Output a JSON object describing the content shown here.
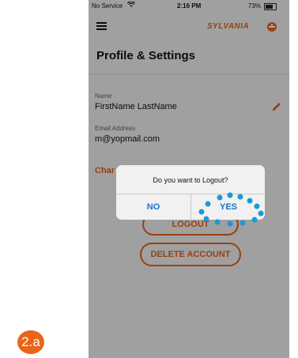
{
  "status_bar": {
    "carrier": "No Service",
    "time": "2:16 PM",
    "battery": "73%"
  },
  "header": {
    "brand": "SYLVANIA",
    "menu_icon": "hamburger-menu-icon"
  },
  "page": {
    "title": "Profile & Settings"
  },
  "profile": {
    "name_label": "Name",
    "name_value": "FirstName LastName",
    "email_label": "Email Address",
    "email_value": "m@yopmail.com",
    "change_link": "Char"
  },
  "buttons": {
    "logout": "LOGOUT",
    "delete_account": "DELETE ACCOUNT"
  },
  "dialog": {
    "message": "Do you want to Logout?",
    "no_label": "NO",
    "yes_label": "YES"
  },
  "step_badge": "2.a",
  "colors": {
    "accent": "#e8651a",
    "dialog_button": "#1e6fc8",
    "tap_indicator": "#1a9ad6"
  }
}
